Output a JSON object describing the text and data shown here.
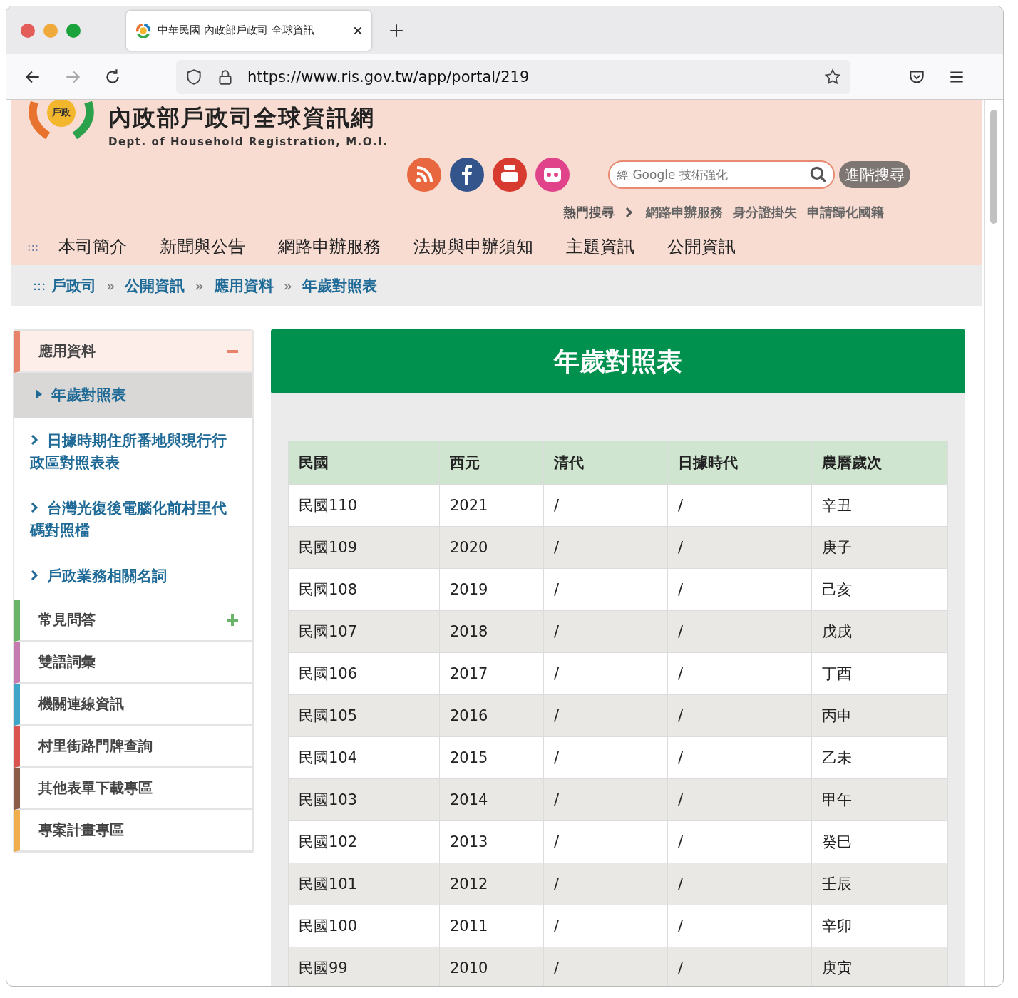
{
  "browser": {
    "tab_title": "中華民國 內政部戶政司 全球資訊",
    "url": "https://www.ris.gov.tw/app/portal/219"
  },
  "header": {
    "logo_text": "戶政",
    "site_title": "內政部戶政司全球資訊網",
    "site_subtitle": "Dept. of Household Registration, M.O.I.",
    "search": {
      "placeholder": "經 Google 技術強化",
      "advanced": "進階搜尋"
    },
    "hot_label": "熱門搜尋",
    "hot_links": [
      "網路申辦服務",
      "身分證掛失",
      "申請歸化國籍"
    ]
  },
  "nav": {
    "marker": ":::",
    "items": [
      "本司簡介",
      "新聞與公告",
      "網路申辦服務",
      "法規與申辦須知",
      "主題資訊",
      "公開資訊"
    ]
  },
  "breadcrumb": {
    "marker": ":::",
    "separator": "»",
    "items": [
      "戶政司",
      "公開資訊",
      "應用資料",
      "年歲對照表"
    ]
  },
  "sidebar": [
    {
      "label": "應用資料",
      "color": "#e8826a",
      "kind": "toggle",
      "expanded": true,
      "children": [
        {
          "label": "年歲對照表",
          "selected": true
        },
        {
          "label": "日據時期住所番地與現行行政區對照表表",
          "selected": false
        },
        {
          "label": "台灣光復後電腦化前村里代碼對照檔",
          "selected": false
        },
        {
          "label": "戶政業務相關名詞",
          "selected": false
        }
      ]
    },
    {
      "label": "常見問答",
      "color": "#6ab46a",
      "kind": "toggle",
      "expanded": false
    },
    {
      "label": "雙語詞彙",
      "color": "#c57bb0",
      "kind": "plain",
      "expanded": false
    },
    {
      "label": "機關連線資訊",
      "color": "#3fa5c8",
      "kind": "plain",
      "expanded": false
    },
    {
      "label": "村里街路門牌查詢",
      "color": "#d9534f",
      "kind": "plain",
      "expanded": false
    },
    {
      "label": "其他表單下載專區",
      "color": "#8b5a48",
      "kind": "plain",
      "expanded": false
    },
    {
      "label": "專案計畫專區",
      "color": "#f0ad4e",
      "kind": "plain",
      "expanded": false
    }
  ],
  "page_title": "年歲對照表",
  "table": {
    "columns": [
      "民國",
      "西元",
      "清代",
      "日據時代",
      "農曆歲次"
    ],
    "rows": [
      [
        "民國110",
        "2021",
        "/",
        "/",
        "辛丑"
      ],
      [
        "民國109",
        "2020",
        "/",
        "/",
        "庚子"
      ],
      [
        "民國108",
        "2019",
        "/",
        "/",
        "己亥"
      ],
      [
        "民國107",
        "2018",
        "/",
        "/",
        "戊戌"
      ],
      [
        "民國106",
        "2017",
        "/",
        "/",
        "丁酉"
      ],
      [
        "民國105",
        "2016",
        "/",
        "/",
        "丙申"
      ],
      [
        "民國104",
        "2015",
        "/",
        "/",
        "乙未"
      ],
      [
        "民國103",
        "2014",
        "/",
        "/",
        "甲午"
      ],
      [
        "民國102",
        "2013",
        "/",
        "/",
        "癸巳"
      ],
      [
        "民國101",
        "2012",
        "/",
        "/",
        "壬辰"
      ],
      [
        "民國100",
        "2011",
        "/",
        "/",
        "辛卯"
      ],
      [
        "民國99",
        "2010",
        "/",
        "/",
        "庚寅"
      ]
    ]
  }
}
